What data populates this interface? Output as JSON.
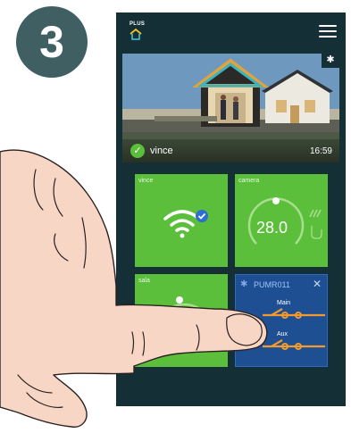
{
  "step": {
    "number": "3"
  },
  "app": {
    "logo_text": "PLUS"
  },
  "hero": {
    "name": "vince",
    "time": "16:59"
  },
  "tiles": {
    "wifi": {
      "label": "vince"
    },
    "thermo": {
      "label": "camera",
      "value": "28.0"
    },
    "sala": {
      "label": "sala",
      "level": 0.5
    },
    "pump": {
      "title": "PUMR011",
      "switch_main_label": "Main",
      "switch_aux_label": "Aux"
    }
  },
  "colors": {
    "tile_green": "#5cbf3c",
    "tile_blue": "#1e4f93",
    "phone_bg": "#142f36",
    "switch_orange": "#f29a2e",
    "badge": "#3f5f63"
  }
}
